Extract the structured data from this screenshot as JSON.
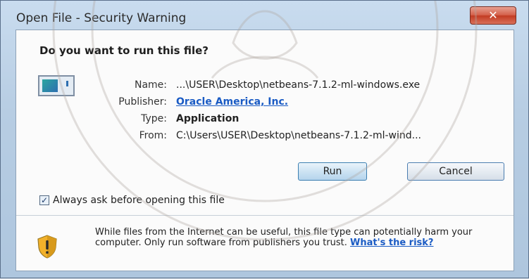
{
  "window": {
    "title": "Open File - Security Warning",
    "close_glyph": "✕"
  },
  "dialog": {
    "heading": "Do you want to run this file?",
    "file_icon": "application-icon",
    "fields": {
      "name_label": "Name:",
      "name_value": "...\\USER\\Desktop\\netbeans-7.1.2-ml-windows.exe",
      "publisher_label": "Publisher:",
      "publisher_value": "Oracle America, Inc.",
      "type_label": "Type:",
      "type_value": "Application",
      "from_label": "From:",
      "from_value": "C:\\Users\\USER\\Desktop\\netbeans-7.1.2-ml-wind..."
    },
    "buttons": {
      "run": "Run",
      "cancel": "Cancel"
    },
    "checkbox": {
      "label": "Always ask before opening this file",
      "checked": true,
      "check_glyph": "✓"
    },
    "warning": {
      "icon": "shield-warning-icon",
      "text": "While files from the Internet can be useful, this file type can potentially harm your computer. Only run software from publishers you trust.",
      "link": "What's the risk?"
    }
  },
  "colors": {
    "accent_link": "#1a5bc4",
    "close_button": "#c23b22",
    "shield_yellow": "#f2b12a"
  }
}
